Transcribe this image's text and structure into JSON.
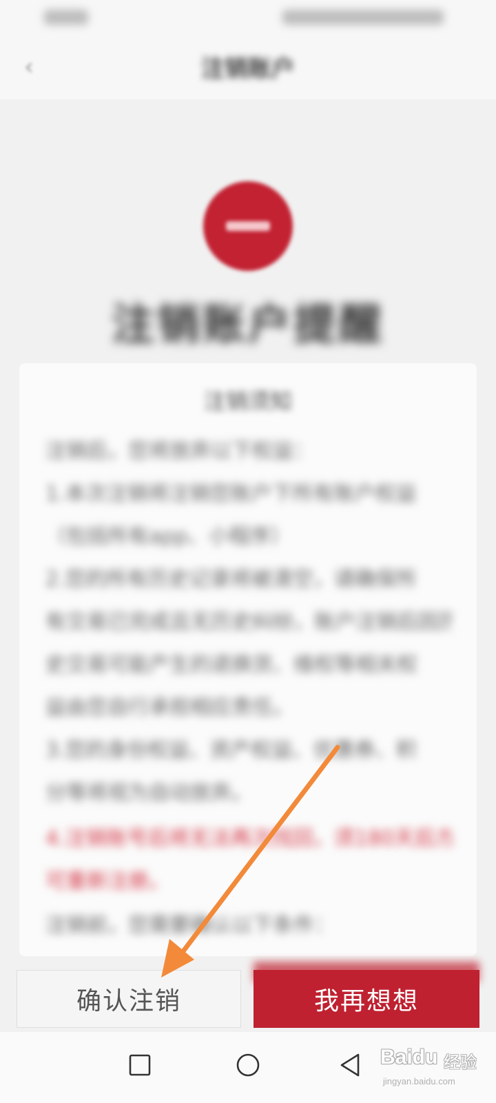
{
  "header": {
    "back_icon": "chevron-left-icon",
    "title": "注销账户"
  },
  "warning": {
    "icon": "minus-circle-icon",
    "icon_color": "#c22232",
    "headline": "注销账户提醒"
  },
  "notice": {
    "title": "注销须知",
    "lines": [
      "注销后，您将放弃以下权益：",
      "1.本次注销将注销您账户下所有账户权益",
      "（包括所有app、小程序）",
      "2.您的所有历史记录将被清空，请确保所",
      "有交易已完成且无历史纠纷，账户注销后因历",
      "史交易可能产生的退换货、维权等相关权",
      "益由您自行承担相应责任。",
      "3.您的身份权益、资产权益、优惠券、积",
      "分等将视为自动放弃。",
      "4.注销账号后将无法再次找回，须180天后方",
      "可重新注册。",
      "注销前，您需要确认以下条件："
    ],
    "red_line_indices": [
      9,
      10
    ],
    "red_color": "#d33a48"
  },
  "actions": {
    "confirm_label": "确认注销",
    "rethink_label": "我再想想",
    "primary_color": "#bf2130"
  },
  "nav": {
    "recents_icon": "square-icon",
    "home_icon": "circle-icon",
    "back_icon": "triangle-back-icon"
  },
  "annotation": {
    "arrow_color": "#f28a3a",
    "arrow_icon": "arrow-icon"
  },
  "watermark": {
    "logo": "Baidu",
    "cn": "经验",
    "url": "jingyan.baidu.com"
  }
}
